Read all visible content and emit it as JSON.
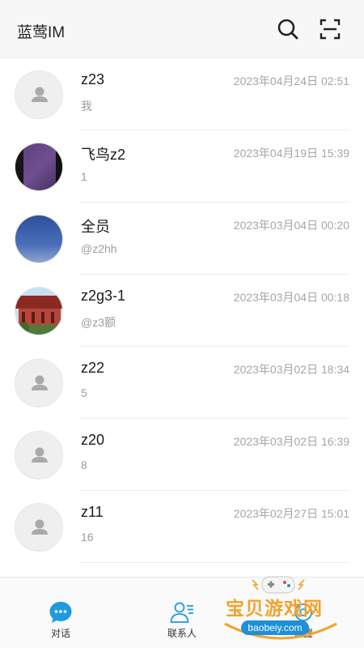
{
  "app_bar": {
    "title": "蓝莺IM",
    "search_icon": "search-icon",
    "scan_icon": "scan-icon"
  },
  "chats": [
    {
      "name": "z23",
      "time": "2023年04月24日 02:51",
      "preview": "我",
      "avatar": "default-person"
    },
    {
      "name": "飞鸟z2",
      "time": "2023年04月19日 15:39",
      "preview": "1",
      "avatar": "purple-photo"
    },
    {
      "name": "全员",
      "time": "2023年03月04日 00:20",
      "preview": "@z2hh",
      "avatar": "blue-sky-photo"
    },
    {
      "name": "z2g3-1",
      "time": "2023年03月04日 00:18",
      "preview": "@z3额",
      "avatar": "building-photo"
    },
    {
      "name": "z22",
      "time": "2023年03月02日 18:34",
      "preview": "5",
      "avatar": "default-person"
    },
    {
      "name": "z20",
      "time": "2023年03月02日 16:39",
      "preview": "8",
      "avatar": "default-person"
    },
    {
      "name": "z11",
      "time": "2023年02月27日 15:01",
      "preview": "16",
      "avatar": "default-person"
    }
  ],
  "tab_bar": {
    "tabs": [
      {
        "label": "对话",
        "icon": "chat-bubble-icon",
        "active": true
      },
      {
        "label": "联系人",
        "icon": "contacts-icon",
        "active": false
      },
      {
        "label": "设置",
        "icon": "settings-icon",
        "active": false
      }
    ]
  },
  "watermark": {
    "text": "宝贝游戏网",
    "url": "baobeiy.com"
  },
  "colors": {
    "accent": "#1e9be0",
    "watermark_orange": "#f2a32a",
    "time_gray": "#a6a6a6"
  }
}
